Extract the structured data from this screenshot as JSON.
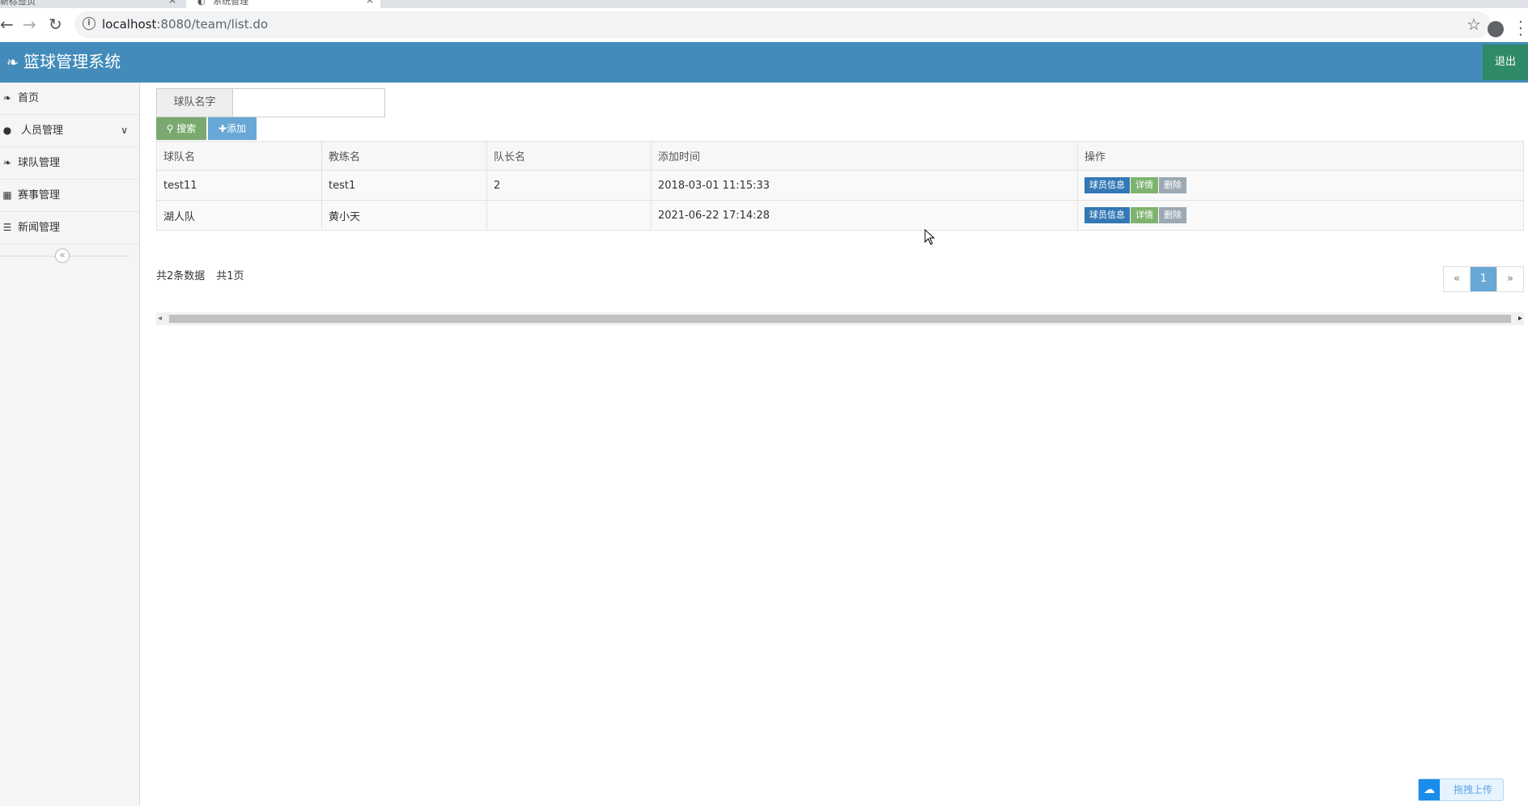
{
  "browser": {
    "tabs": [
      {
        "title": "新标签页",
        "close": "×"
      },
      {
        "title": "系统管理",
        "close": "×"
      }
    ],
    "url_host": "localhost",
    "url_path": ":8080/team/list.do"
  },
  "header": {
    "title": "篮球管理系统",
    "logout_label": "退出"
  },
  "sidebar": {
    "items": [
      {
        "label": "首页"
      },
      {
        "label": "人员管理"
      },
      {
        "label": "球队管理"
      },
      {
        "label": "赛事管理"
      },
      {
        "label": "新闻管理"
      }
    ]
  },
  "search": {
    "label": "球队名字",
    "value": "",
    "search_label": "搜索",
    "add_label": "添加"
  },
  "table": {
    "columns": [
      "球队名",
      "教练名",
      "队长名",
      "添加时间",
      "操作"
    ],
    "rows": [
      {
        "team": "test11",
        "coach": "test1",
        "captain": "2",
        "time": "2018-03-01 11:15:33"
      },
      {
        "team": "湖人队",
        "coach": "黄小天",
        "captain": "",
        "time": "2021-06-22 17:14:28"
      }
    ],
    "actions": {
      "info": "球员信息",
      "detail": "详情",
      "delete": "删除"
    }
  },
  "pagination": {
    "total_records": "共2条数据",
    "total_pages": "共1页",
    "prev": "«",
    "current": "1",
    "next": "»"
  },
  "upload_widget": {
    "label": "拖拽上传"
  },
  "colors": {
    "header": "#428bba",
    "logout": "#2f8a68",
    "search_btn": "#7aa96f",
    "add_btn": "#68a8d6",
    "info_btn": "#3479b6",
    "detail_btn": "#7eb36f",
    "delete_btn": "#9ca9b3"
  }
}
